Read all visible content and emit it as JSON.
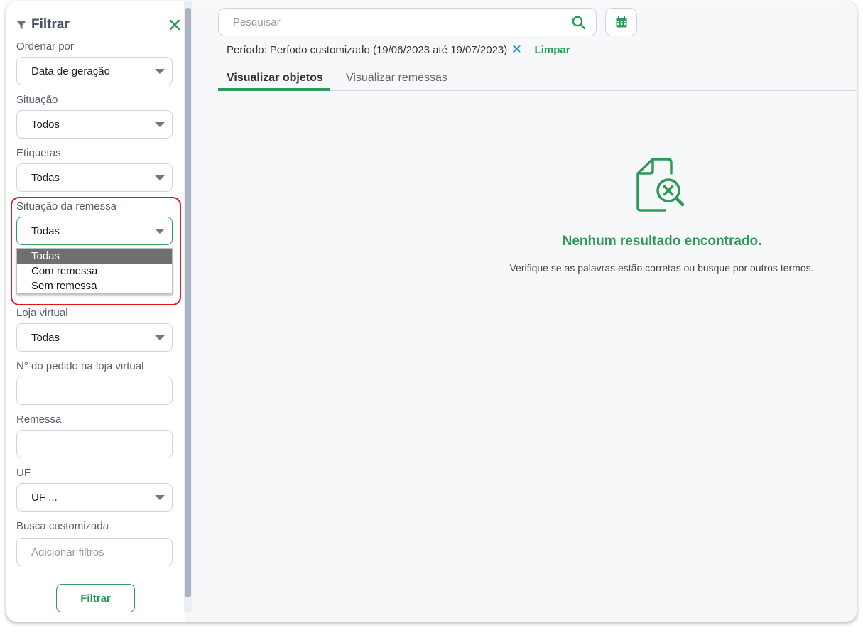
{
  "sidebar": {
    "title": "Filtrar",
    "fields": {
      "ordenar_por": {
        "label": "Ordenar por",
        "value": "Data de geração"
      },
      "situacao": {
        "label": "Situação",
        "value": "Todos"
      },
      "etiquetas": {
        "label": "Etiquetas",
        "value": "Todas"
      },
      "situacao_remessa": {
        "label": "Situação da remessa",
        "value": "Todas",
        "options": [
          "Todas",
          "Com remessa",
          "Sem remessa"
        ]
      },
      "loja_virtual": {
        "label": "Loja virtual",
        "value": "Todas"
      },
      "numero_pedido": {
        "label": "N° do pedido na loja virtual",
        "value": ""
      },
      "remessa": {
        "label": "Remessa",
        "value": ""
      },
      "uf": {
        "label": "UF",
        "value": "UF ..."
      },
      "busca_customizada": {
        "label": "Busca customizada",
        "placeholder": "Adicionar filtros"
      }
    },
    "filter_button": "Filtrar"
  },
  "main": {
    "search": {
      "placeholder": "Pesquisar"
    },
    "period": {
      "text": "Período: Período customizado (19/06/2023 até 19/07/2023)",
      "clear_link": "Limpar"
    },
    "tabs": [
      {
        "label": "Visualizar objetos",
        "active": true
      },
      {
        "label": "Visualizar remessas",
        "active": false
      }
    ],
    "empty_state": {
      "title": "Nenhum resultado encontrado.",
      "subtitle": "Verifique se as palavras estão corretas ou busque por outros termos."
    }
  },
  "colors": {
    "accent": "#2e9a57",
    "highlight": "#e1161b",
    "link_blue": "#2aa0d8"
  },
  "icons": [
    "filter-icon",
    "close-icon",
    "search-icon",
    "calendar-icon",
    "document-search-x-icon",
    "chevron-down-icon"
  ]
}
